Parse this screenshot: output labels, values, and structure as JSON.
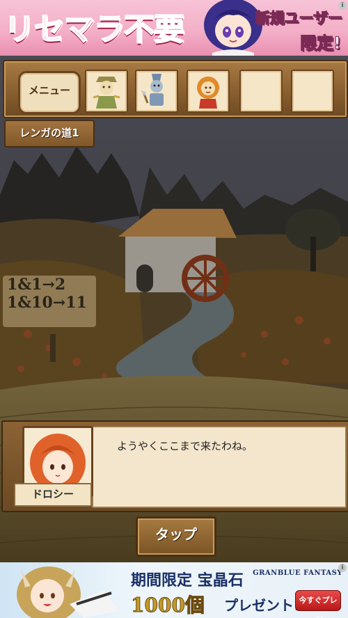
{
  "ad_top": {
    "title": "リセマラ不要",
    "sub_line1": "新規ユーザー",
    "sub_line2": "限定!",
    "info_label": "i"
  },
  "hud": {
    "menu_label": "メニュー",
    "location": "レンガの道1",
    "party_icons": [
      "scarecrow-icon",
      "tin-woodman-icon",
      "lion-icon"
    ],
    "empty_slots": 2
  },
  "hint": {
    "line1": "1&1→2",
    "line2": "1&10→11"
  },
  "dialog": {
    "message": "ようやくここまで来たわね。",
    "speaker": "ドロシー"
  },
  "tap_label": "タップ",
  "ad_bottom": {
    "headline_prefix": "期間限定",
    "headline_item": "宝晶石",
    "amount": "1000個",
    "amount_suffix": "プレゼント!",
    "logo": "GRANBLUE FANTASY",
    "cta": "今すぐプレイ!",
    "info_label": "i"
  },
  "colors": {
    "wood": "#8c6232",
    "paper": "#f3e6cc",
    "ad_top_pink": "#e8486e",
    "ad_bottom_gold": "#c49a28"
  }
}
